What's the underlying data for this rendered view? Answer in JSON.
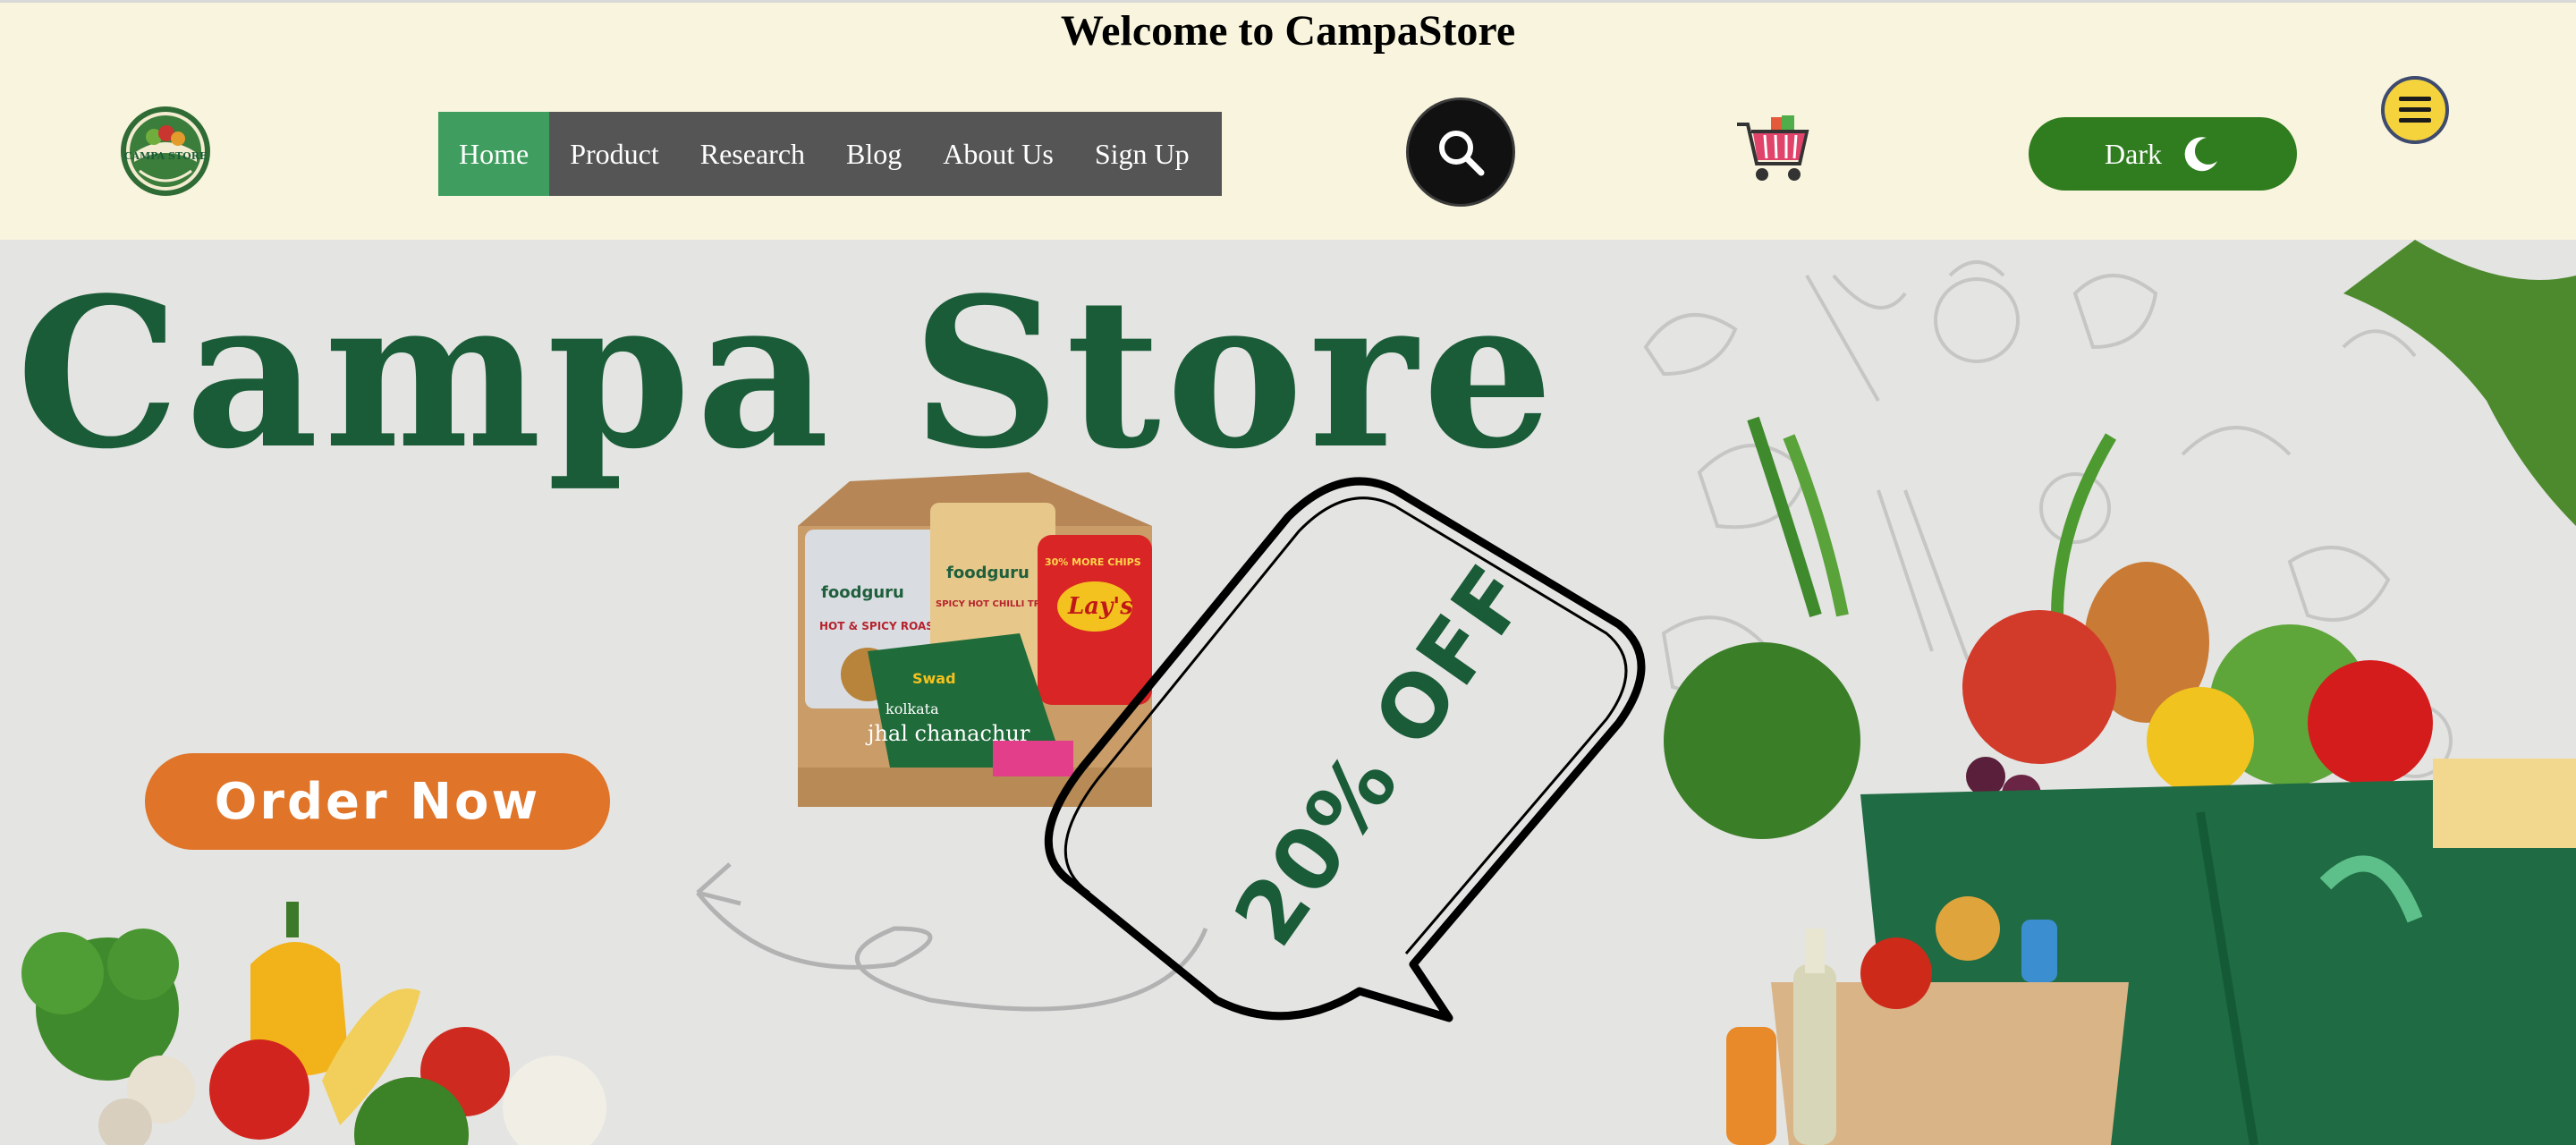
{
  "header": {
    "welcome": "Welcome to CampaStore",
    "logo": {
      "text": "CAMPA STORE",
      "icon": "campa-store-logo"
    },
    "nav": [
      {
        "label": "Home",
        "active": true
      },
      {
        "label": "Product",
        "active": false
      },
      {
        "label": "Research",
        "active": false
      },
      {
        "label": "Blog",
        "active": false
      },
      {
        "label": "About Us",
        "active": false
      },
      {
        "label": "Sign Up",
        "active": false
      }
    ],
    "search_icon": "search-icon",
    "cart_icon": "cart-icon",
    "theme_toggle": {
      "label": "Dark",
      "icon": "moon-icon"
    },
    "menu_icon": "hamburger-menu-icon"
  },
  "hero": {
    "title": "Campa Store",
    "promo": "20% OFF",
    "order_button": "Order Now",
    "snack_box_labels": [
      "foodguru",
      "HOT & SPICY ROASTED",
      "foodguru",
      "SPICY HOT CHILLI TREAT",
      "Lay's",
      "30% MORE CHIPS",
      "Swad",
      "kolkata",
      "jhal chanachur"
    ]
  },
  "colors": {
    "header_bg": "#f8f4dd",
    "nav_bg": "#555555",
    "nav_active": "#3f9e5f",
    "toggle_bg": "#2f7d1f",
    "title_green": "#1a5c38",
    "order_orange": "#e07428",
    "menu_yellow": "#f5d33d"
  }
}
